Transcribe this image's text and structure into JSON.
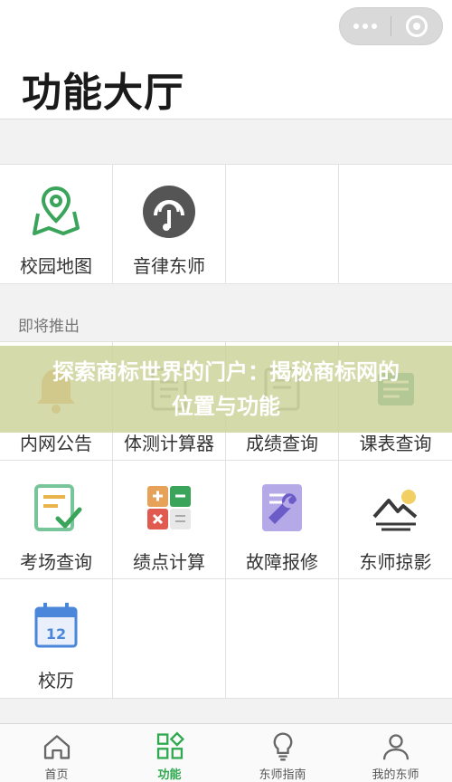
{
  "page": {
    "title": "功能大厅"
  },
  "section_coming": "即将推出",
  "grid_top": [
    {
      "label": "校园地图",
      "icon": "map-pin-icon"
    },
    {
      "label": "音律东师",
      "icon": "music-icon"
    }
  ],
  "grid_coming": [
    {
      "label": "内网公告",
      "icon": "bell-icon"
    },
    {
      "label": "体测计算器",
      "icon": "fitness-calc-icon"
    },
    {
      "label": "成绩查询",
      "icon": "grade-icon"
    },
    {
      "label": "课表查询",
      "icon": "schedule-icon"
    },
    {
      "label": "考场查询",
      "icon": "exam-check-icon"
    },
    {
      "label": "绩点计算",
      "icon": "calculator-icon"
    },
    {
      "label": "故障报修",
      "icon": "wrench-icon"
    },
    {
      "label": "东师掠影",
      "icon": "landscape-icon"
    },
    {
      "label": "校历",
      "icon": "calendar-icon"
    }
  ],
  "calendar_number": "12",
  "overlay": {
    "text": "探索商标世界的门户：揭秘商标网的位置与功能"
  },
  "tabs": [
    {
      "label": "首页",
      "icon": "home-icon"
    },
    {
      "label": "功能",
      "icon": "grid-icon"
    },
    {
      "label": "东师指南",
      "icon": "lightbulb-icon"
    },
    {
      "label": "我的东师",
      "icon": "person-icon"
    }
  ],
  "colors": {
    "accent": "#2fa84f",
    "overlay": "#cad296"
  }
}
